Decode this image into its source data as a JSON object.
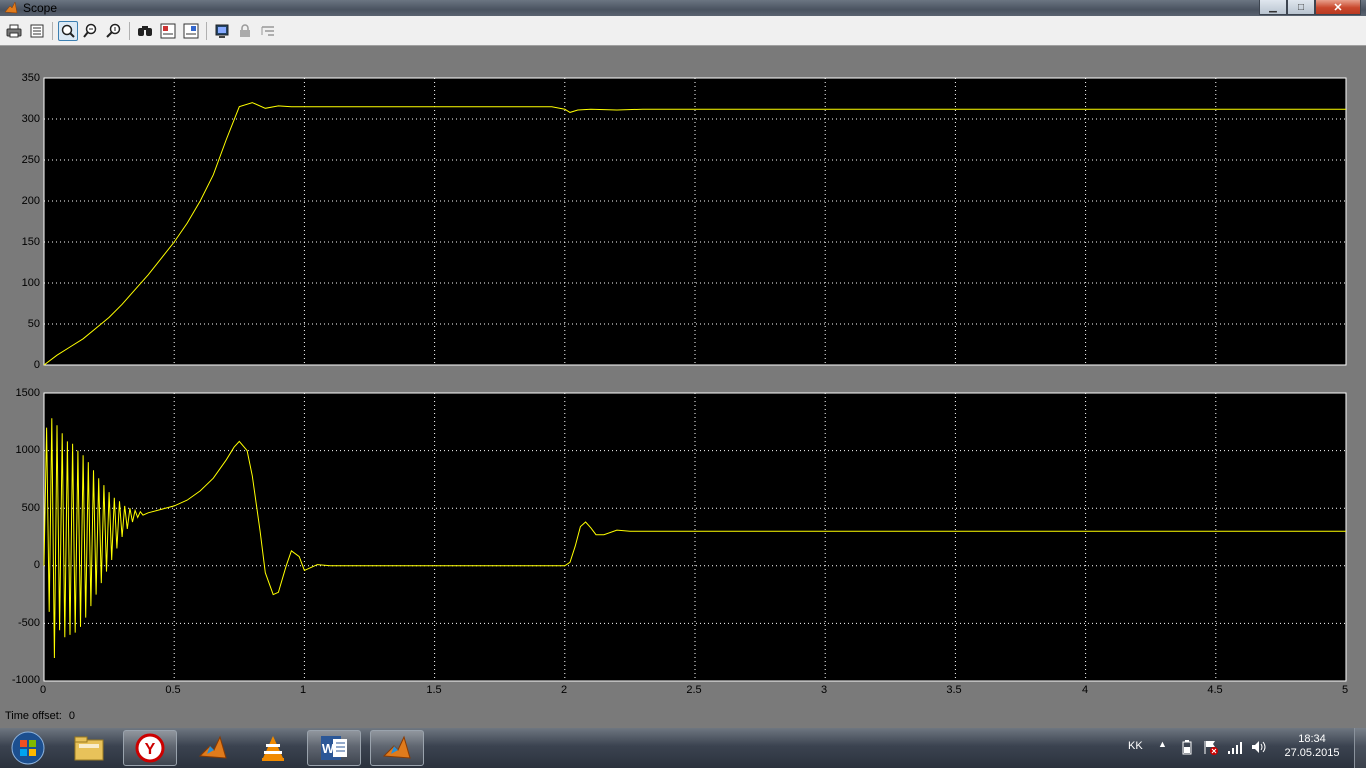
{
  "window": {
    "title": "Scope",
    "minimize_glyph": "▁",
    "maximize_glyph": "□",
    "close_glyph": "✕"
  },
  "toolbar": {
    "items": [
      "print-icon",
      "parameters-icon",
      "zoom-icon",
      "zoom-x-icon",
      "zoom-y-icon",
      "autoscale-icon",
      "save-axes-icon",
      "restore-axes-icon",
      "floating-scope-icon",
      "lock-axes-icon",
      "signal-selector-icon"
    ]
  },
  "plot_top": {
    "yticks": [
      "350",
      "300",
      "250",
      "200",
      "150",
      "100",
      "50",
      "0"
    ]
  },
  "plot_bottom": {
    "yticks": [
      "1500",
      "1000",
      "500",
      "0",
      "-500",
      "-1000"
    ]
  },
  "xticks": [
    "0",
    "0.5",
    "1",
    "1.5",
    "2",
    "2.5",
    "3",
    "3.5",
    "4",
    "4.5",
    "5"
  ],
  "time_offset": {
    "label": "Time offset:",
    "value": "0"
  },
  "chart_data": [
    {
      "type": "line",
      "xlim": [
        0,
        5
      ],
      "ylim": [
        0,
        350
      ],
      "grid": true,
      "background": "#000000",
      "line_color": "#ffff00",
      "series": [
        {
          "x": [
            0,
            0.05,
            0.1,
            0.15,
            0.2,
            0.25,
            0.3,
            0.35,
            0.4,
            0.45,
            0.5,
            0.55,
            0.6,
            0.65,
            0.7,
            0.75,
            0.8,
            0.85,
            0.9,
            0.95,
            1.0,
            1.5,
            1.95,
            2.0,
            2.02,
            2.05,
            2.1,
            2.2,
            2.3,
            5.0
          ],
          "y": [
            0,
            12,
            22,
            32,
            45,
            58,
            74,
            92,
            110,
            130,
            150,
            173,
            200,
            232,
            275,
            315,
            320,
            313,
            316,
            315,
            315,
            315,
            315,
            312,
            308,
            311,
            312,
            311,
            312,
            312
          ]
        }
      ]
    },
    {
      "type": "line",
      "xlim": [
        0,
        5
      ],
      "ylim": [
        -1000,
        1500
      ],
      "grid": true,
      "background": "#000000",
      "line_color": "#ffff00",
      "series": [
        {
          "x": [
            0,
            0.01,
            0.02,
            0.03,
            0.04,
            0.05,
            0.06,
            0.07,
            0.08,
            0.09,
            0.1,
            0.11,
            0.12,
            0.13,
            0.14,
            0.15,
            0.16,
            0.17,
            0.18,
            0.19,
            0.2,
            0.21,
            0.22,
            0.23,
            0.24,
            0.25,
            0.26,
            0.27,
            0.28,
            0.29,
            0.3,
            0.31,
            0.32,
            0.33,
            0.34,
            0.35,
            0.36,
            0.37,
            0.38,
            0.4,
            0.45,
            0.5,
            0.55,
            0.6,
            0.65,
            0.7,
            0.73,
            0.75,
            0.78,
            0.8,
            0.83,
            0.85,
            0.88,
            0.9,
            0.93,
            0.95,
            0.98,
            1.0,
            1.05,
            1.1,
            1.5,
            1.95,
            2.0,
            2.02,
            2.04,
            2.06,
            2.08,
            2.1,
            2.12,
            2.15,
            2.2,
            2.25,
            2.3,
            5.0
          ],
          "y": [
            0,
            1200,
            -400,
            1280,
            -800,
            1220,
            -560,
            1150,
            -620,
            1080,
            -600,
            1060,
            -580,
            1000,
            -530,
            960,
            -450,
            900,
            -350,
            830,
            -250,
            760,
            -150,
            700,
            -50,
            640,
            50,
            590,
            150,
            560,
            250,
            520,
            320,
            500,
            380,
            480,
            420,
            470,
            440,
            460,
            490,
            520,
            570,
            650,
            760,
            920,
            1030,
            1080,
            1000,
            780,
            300,
            -60,
            -250,
            -230,
            0,
            130,
            80,
            -40,
            10,
            0,
            0,
            0,
            0,
            30,
            170,
            340,
            380,
            330,
            270,
            270,
            310,
            300,
            300,
            300
          ]
        }
      ]
    }
  ],
  "taskbar": {
    "start": "windows-start-icon",
    "apps": [
      "file-explorer-icon",
      "yandex-browser-icon",
      "matlab-icon",
      "vlc-icon",
      "word-icon",
      "matlab-simulink-icon"
    ],
    "word_glyph": "W",
    "yandex_glyph": "Y",
    "language": "KK",
    "time": "18:34",
    "date": "27.05.2015"
  }
}
